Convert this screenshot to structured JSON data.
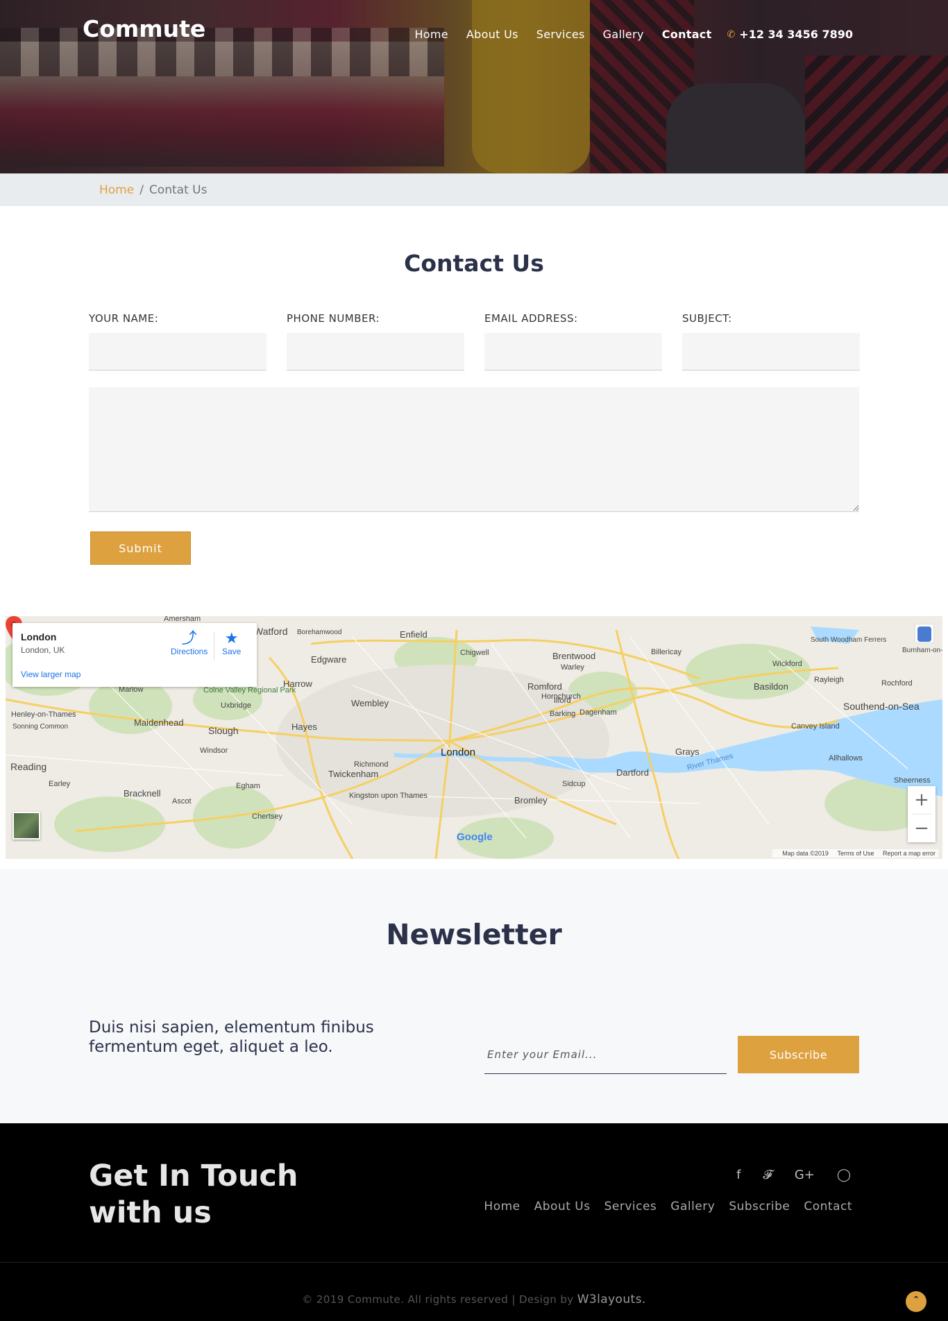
{
  "brand": "Commute",
  "nav": {
    "items": [
      "Home",
      "About Us",
      "Services",
      "Gallery",
      "Contact"
    ],
    "active": "Contact",
    "phone": "+12 34 3456 7890"
  },
  "breadcrumb": {
    "home": "Home",
    "separator": "/",
    "current": "Contat Us"
  },
  "contact": {
    "title": "Contact Us",
    "fields": [
      {
        "label": "YOUR NAME:",
        "value": ""
      },
      {
        "label": "PHONE NUMBER:",
        "value": ""
      },
      {
        "label": "EMAIL ADDRESS:",
        "value": ""
      },
      {
        "label": "SUBJECT:",
        "value": ""
      }
    ],
    "message_value": "",
    "submit_label": "Submit"
  },
  "map": {
    "place_name": "London",
    "place_sub": "London, UK",
    "view_larger": "View larger map",
    "directions": "Directions",
    "save": "Save",
    "pin_label": "London",
    "labels": [
      "Amersham",
      "Watford",
      "Borehamwood",
      "Enfield",
      "South Woodham Ferrers",
      "Burnham-on-",
      "Edgware",
      "Chigwell",
      "Brentwood",
      "Warley",
      "Billericay",
      "Wickford",
      "Marlow",
      "Harrow",
      "Colne Valley Regional Park",
      "Uxbridge",
      "Romford",
      "Hornchurch",
      "Basildon",
      "Rayleigh",
      "Rochford",
      "Wembley",
      "Ilford",
      "Barking",
      "Dagenham",
      "Southend-on-Sea",
      "Henley-on-Thames",
      "Sonning Common",
      "Maidenhead",
      "Slough",
      "Hayes",
      "Canvey Island",
      "Windsor",
      "Richmond",
      "Twickenham",
      "Grays",
      "River Thames",
      "Allhallows",
      "Reading",
      "Earley",
      "Bracknell",
      "Ascot",
      "Egham",
      "Kingston upon Thames",
      "Chertsey",
      "Sidcup",
      "Bromley",
      "Dartford",
      "Sheerness"
    ],
    "attribution": "Map data ©2019",
    "terms": "Terms of Use",
    "report": "Report a map error",
    "google": "Google"
  },
  "newsletter": {
    "title": "Newsletter",
    "text": "Duis nisi sapien, elementum finibus fermentum eget, aliquet a leo.",
    "placeholder": "Enter your Email...",
    "button": "Subscribe"
  },
  "footer": {
    "title": "Get In Touch with us",
    "socials": [
      "facebook-icon",
      "twitter-icon",
      "google-plus-icon",
      "instagram-icon"
    ],
    "links": [
      "Home",
      "About Us",
      "Services",
      "Gallery",
      "Subscribe",
      "Contact"
    ],
    "copyright": "© 2019 Commute. All rights reserved | Design by",
    "designer": "W3layouts."
  },
  "colors": {
    "accent": "#dda13f",
    "dark": "#2b3149",
    "breadcrumb_bg": "#e9ecef"
  }
}
